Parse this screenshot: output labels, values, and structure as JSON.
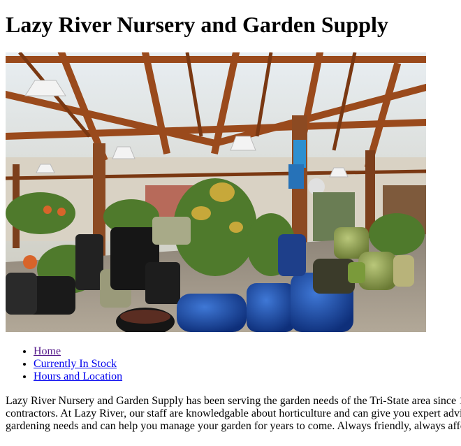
{
  "page": {
    "title": "Lazy River Nursery and Garden Supply"
  },
  "hero_image": {
    "description_icon": "nursery-photo"
  },
  "nav": {
    "items": [
      {
        "label": "Home",
        "visited": true
      },
      {
        "label": "Currently In Stock",
        "visited": false
      },
      {
        "label": "Hours and Location",
        "visited": false
      }
    ]
  },
  "intro": {
    "text": "Lazy River Nursery and Garden Supply has been serving the garden needs of the Tri-State area since 1 contractors. At Lazy River, our staff are knowledgable about horticulture and can give you expert advi gardening needs and can help you manage your garden for years to come. Always friendly, always affo"
  },
  "colors": {
    "link": "#0000ee",
    "visited_link": "#551a8b"
  }
}
